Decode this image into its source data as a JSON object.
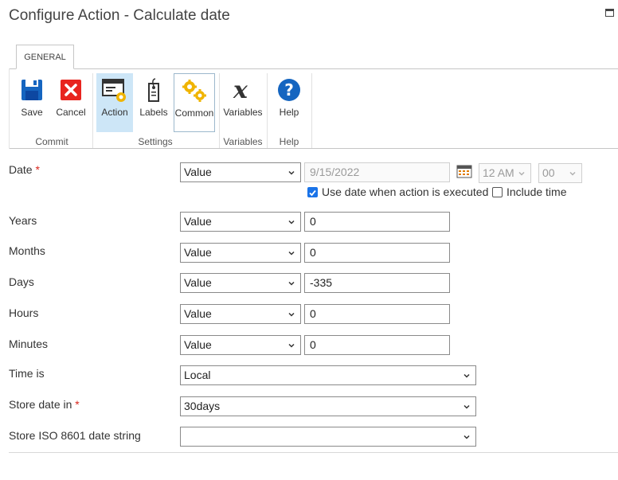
{
  "window": {
    "title": "Configure Action - Calculate date"
  },
  "ribbon": {
    "tab": "GENERAL",
    "buttons": {
      "save": "Save",
      "cancel": "Cancel",
      "action": "Action",
      "labels": "Labels",
      "common": "Common",
      "variables": "Variables",
      "help": "Help"
    },
    "groups": {
      "commit": "Commit",
      "settings": "Settings",
      "variables": "Variables",
      "help": "Help"
    }
  },
  "form": {
    "required_mark": "*",
    "date": {
      "label": "Date",
      "type": "Value",
      "value": "9/15/2022",
      "hour": "12 AM",
      "minute": "00",
      "use_exec_date_label": "Use date when action is executed",
      "use_exec_date_checked": true,
      "include_time_label": "Include time",
      "include_time_checked": false
    },
    "years": {
      "label": "Years",
      "type": "Value",
      "value": "0"
    },
    "months": {
      "label": "Months",
      "type": "Value",
      "value": "0"
    },
    "days": {
      "label": "Days",
      "type": "Value",
      "value": "-335"
    },
    "hours": {
      "label": "Hours",
      "type": "Value",
      "value": "0"
    },
    "minutes": {
      "label": "Minutes",
      "type": "Value",
      "value": "0"
    },
    "time_is": {
      "label": "Time is",
      "value": "Local"
    },
    "store_date_in": {
      "label": "Store date in",
      "value": "30days"
    },
    "store_iso": {
      "label": "Store ISO 8601 date string",
      "value": ""
    }
  },
  "colors": {
    "accent": "#1a73e8",
    "required": "#d9261c",
    "selected_bg": "#cde6f7"
  }
}
